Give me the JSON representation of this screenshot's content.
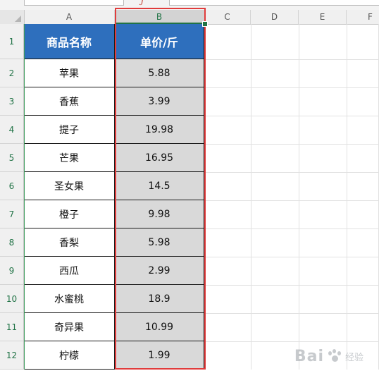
{
  "column_headers": [
    "A",
    "B",
    "C",
    "D",
    "E",
    "F"
  ],
  "row_headers": [
    "1",
    "2",
    "3",
    "4",
    "5",
    "6",
    "7",
    "8",
    "9",
    "10",
    "11",
    "12"
  ],
  "table": {
    "header": {
      "name": "商品名称",
      "price": "单价/斤"
    },
    "rows": [
      {
        "name": "苹果",
        "price": "5.88"
      },
      {
        "name": "香蕉",
        "price": "3.99"
      },
      {
        "name": "提子",
        "price": "19.98"
      },
      {
        "name": "芒果",
        "price": "16.95"
      },
      {
        "name": "圣女果",
        "price": "14.5"
      },
      {
        "name": "橙子",
        "price": "9.98"
      },
      {
        "name": "香梨",
        "price": "5.98"
      },
      {
        "name": "西瓜",
        "price": "2.99"
      },
      {
        "name": "水蜜桃",
        "price": "18.9"
      },
      {
        "name": "奇异果",
        "price": "10.99"
      },
      {
        "name": "柠檬",
        "price": "1.99"
      }
    ]
  },
  "selection": {
    "column": "B",
    "highlight_color": "#e03c3c",
    "accent_color": "#217346"
  },
  "colors": {
    "header_fill": "#2e6fbd",
    "selected_fill": "#d9d9d9"
  },
  "watermark": {
    "brand": "Bai",
    "sub": "经验"
  }
}
